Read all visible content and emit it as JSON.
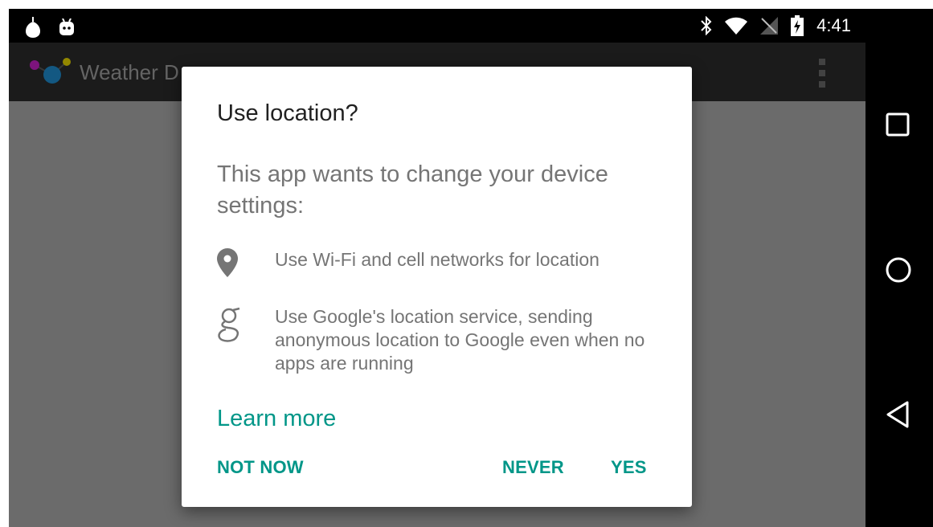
{
  "status_bar": {
    "time": "4:41",
    "left_icons": [
      "notification-pear-icon",
      "android-robot-icon"
    ],
    "right_icons": [
      "bluetooth-icon",
      "wifi-icon",
      "no-sim-signal-icon",
      "battery-charging-icon"
    ]
  },
  "action_bar": {
    "app_title": "Weather D",
    "logo_icon": "app-logo-icon",
    "overflow_icon": "overflow-menu-icon"
  },
  "dialog": {
    "title": "Use location?",
    "message": "This app wants to change your device settings:",
    "items": [
      {
        "icon": "location-pin-icon",
        "text": "Use Wi-Fi and cell networks for location"
      },
      {
        "icon": "google-g-icon",
        "text": "Use Google's location service, sending anonymous location to Google even when no apps are running"
      }
    ],
    "learn_more": "Learn more",
    "buttons": {
      "not_now": "NOT NOW",
      "never": "NEVER",
      "yes": "YES"
    }
  },
  "nav_bar": {
    "icons": [
      "recents-square-icon",
      "home-circle-icon",
      "back-triangle-icon"
    ]
  },
  "colors": {
    "accent": "#009688",
    "scrim": "#6b6b6b",
    "action_bar": "#2a2a2a",
    "dialog_bg": "#ffffff",
    "title_text": "#212121",
    "body_text": "#757575"
  }
}
